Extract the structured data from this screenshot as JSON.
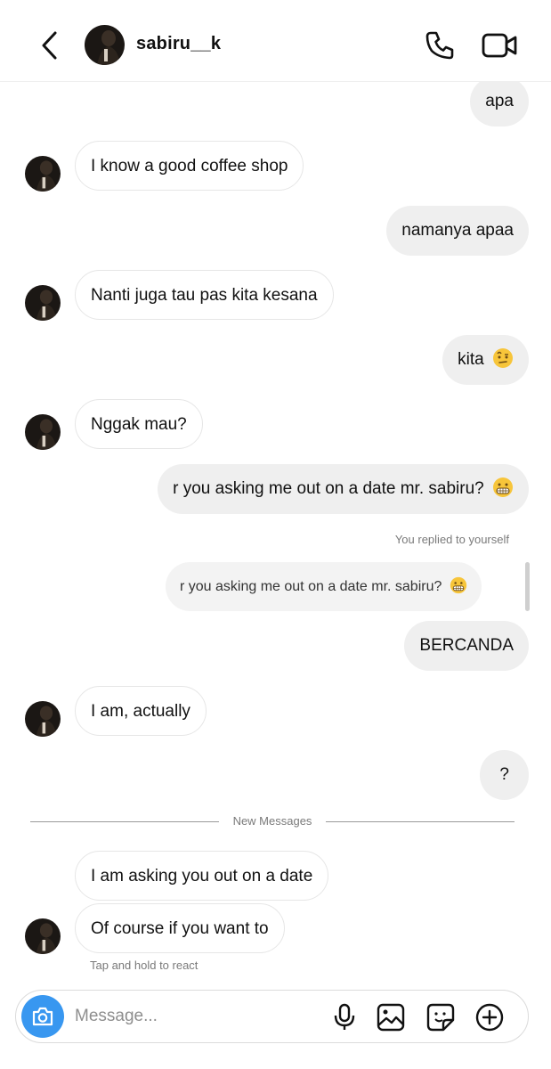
{
  "header": {
    "username": "sabiru__k",
    "back_icon": "chevron-left-icon",
    "call_icon": "phone-icon",
    "video_icon": "video-camera-icon"
  },
  "messages": [
    {
      "from": "me",
      "text": "apa"
    },
    {
      "from": "them",
      "text": "I know a good coffee shop"
    },
    {
      "from": "me",
      "text": "namanya apaa"
    },
    {
      "from": "them",
      "text": "Nanti juga tau pas kita kesana"
    },
    {
      "from": "me",
      "text": "kita",
      "emoji": "raised-eyebrow-emoji"
    },
    {
      "from": "them",
      "text": "Nggak mau?"
    },
    {
      "from": "me",
      "text": "r you asking me out on a date mr. sabiru?",
      "emoji": "grimacing-emoji"
    },
    {
      "from": "me",
      "text": "BERCANDA"
    },
    {
      "from": "them",
      "text": "I am, actually"
    },
    {
      "from": "me",
      "text": "?"
    },
    {
      "from": "them",
      "text": "I am asking you out on a date"
    },
    {
      "from": "them",
      "text": "Of course if you want to"
    }
  ],
  "reply": {
    "label": "You replied to yourself",
    "quoted_text": "r you asking me out on a date mr. sabiru?"
  },
  "divider_label": "New Messages",
  "hint": "Tap and hold to react",
  "composer": {
    "placeholder": "Message...",
    "icons": [
      "camera-icon",
      "microphone-icon",
      "image-icon",
      "sticker-icon",
      "add-icon"
    ]
  },
  "colors": {
    "outgoing_bubble": "#efefef",
    "incoming_border": "#e6e6e6",
    "camera_button": "#3897f0"
  }
}
